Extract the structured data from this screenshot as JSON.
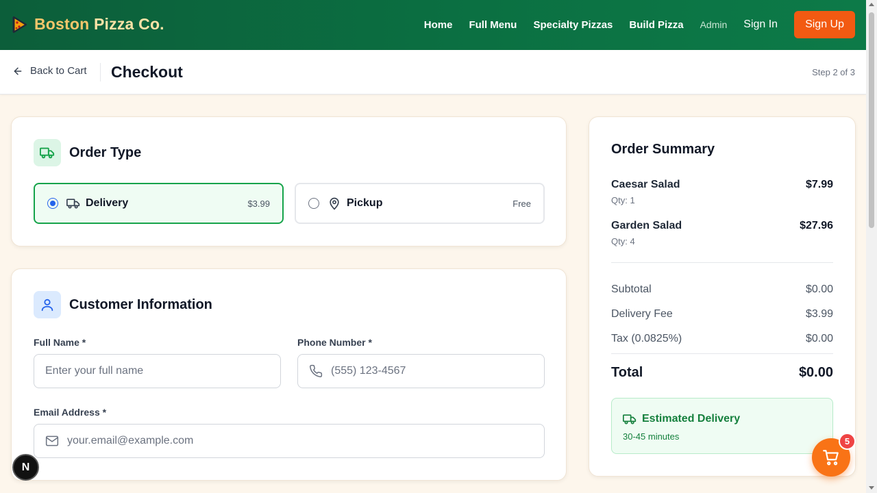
{
  "brand": {
    "word1": "Boston",
    "word2": "Pizza Co."
  },
  "nav": {
    "home": "Home",
    "full_menu": "Full Menu",
    "specialty": "Specialty Pizzas",
    "build": "Build Pizza",
    "admin": "Admin",
    "sign_in": "Sign In",
    "sign_up": "Sign Up"
  },
  "subheader": {
    "back_label": "Back to Cart",
    "title": "Checkout",
    "step": "Step 2 of 3"
  },
  "order_type": {
    "title": "Order Type",
    "delivery": {
      "label": "Delivery",
      "price": "$3.99",
      "selected": true
    },
    "pickup": {
      "label": "Pickup",
      "price": "Free",
      "selected": false
    }
  },
  "customer": {
    "title": "Customer Information",
    "full_name": {
      "label": "Full Name *",
      "value": "",
      "placeholder": "Enter your full name"
    },
    "phone": {
      "label": "Phone Number *",
      "value": "",
      "placeholder": "(555) 123-4567"
    },
    "email": {
      "label": "Email Address *",
      "value": "",
      "placeholder": "your.email@example.com"
    }
  },
  "summary": {
    "title": "Order Summary",
    "items": [
      {
        "name": "Caesar Salad",
        "qty": "Qty: 1",
        "price": "$7.99"
      },
      {
        "name": "Garden Salad",
        "qty": "Qty: 4",
        "price": "$27.96"
      }
    ],
    "subtotal_label": "Subtotal",
    "subtotal": "$0.00",
    "delivery_label": "Delivery Fee",
    "delivery": "$3.99",
    "tax_label": "Tax (0.0825%)",
    "tax": "$0.00",
    "total_label": "Total",
    "total": "$0.00",
    "eta_title": "Estimated Delivery",
    "eta_time": "30-45 minutes"
  },
  "cart": {
    "count": "5"
  },
  "dev_badge": {
    "letter": "N"
  },
  "colors": {
    "header_green": "#0b7042",
    "accent_orange": "#f25a12",
    "selected_green": "#16a34a",
    "radio_blue": "#2563eb"
  },
  "icons": [
    "pizza-logo-icon",
    "arrow-left-icon",
    "truck-icon",
    "map-pin-icon",
    "user-icon",
    "phone-icon",
    "mail-icon",
    "cart-icon"
  ]
}
